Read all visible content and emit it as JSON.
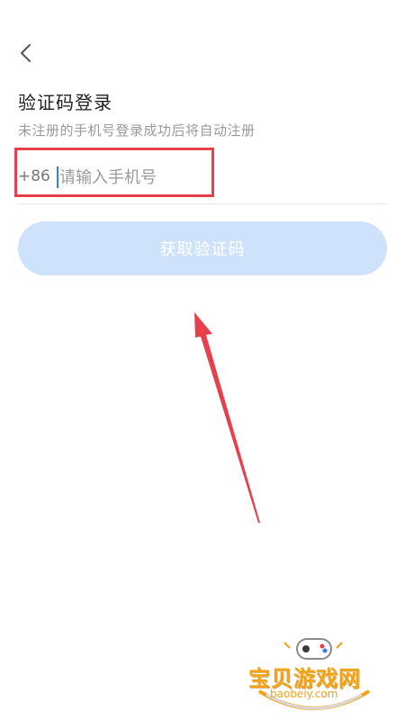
{
  "header": {
    "back_icon": "chevron-left-icon"
  },
  "login": {
    "title": "验证码登录",
    "subtitle": "未注册的手机号登录成功后将自动注册",
    "country_code": "+86",
    "phone_placeholder": "请输入手机号",
    "phone_value": "",
    "get_code_label": "获取验证码"
  },
  "colors": {
    "primary_disabled": "#cfe2fb",
    "caret": "#2f7cf6",
    "annotation_red": "#e5404b",
    "watermark_orange": "#f0a318"
  },
  "watermark": {
    "name": "宝贝游戏网",
    "domain": "baobeiy.com",
    "icon": "gamepad-icon"
  }
}
